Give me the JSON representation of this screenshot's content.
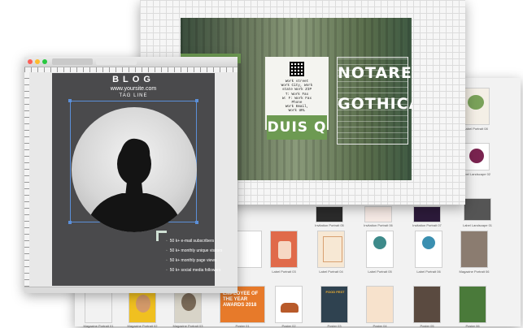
{
  "doc": {
    "blog_title": "BLOG",
    "website": "www.yoursite.com",
    "tagline": "TAG LINE",
    "stats": [
      "50 k+ e-mail subscribers",
      "50 k+ monthly unique visitors",
      "50 k+ monthly page views",
      "50 k+ social media followers"
    ]
  },
  "flyer": {
    "title_line1": "NOTARE",
    "title_line2": "GOTHICA",
    "button": "DUIS Q",
    "contact_lines": [
      "Work street",
      "Work City, Work",
      "state Work ZIP",
      "T: Work Fax",
      "W: F: Work Fax",
      "Phone",
      "Work Email,",
      "Work URL"
    ]
  },
  "browser": {
    "row1_labels": [
      "Invitation Portrait 05",
      "Invitation Portrait 06",
      "Invitation Portrait 07",
      "Label Landscape 01"
    ],
    "row2_labels": [
      "Label Portrait 03",
      "Label Portrait 04",
      "Label Portrait 05",
      "Label Portrait 06",
      "Magazine Portrait 06"
    ],
    "row3_labels": [
      "Magazine Portrait 01",
      "Magazine Portrait 02",
      "Magazine Portrait 03",
      "Poster 01",
      "Poster 02",
      "Poster 03",
      "Poster 04",
      "Poster 05",
      "Poster 06"
    ],
    "side_labels": [
      "Label Portrait 08",
      "Label Landscape 02"
    ],
    "poster_headline": "EMPLOYEE OF THE YEAR AWARDS 2018",
    "poster_small": "FOOD FEST"
  },
  "colors": {
    "accent_green": "#6d9a52",
    "doc_bg": "#4a4a4c",
    "flyer_left": "#3f5a43"
  }
}
